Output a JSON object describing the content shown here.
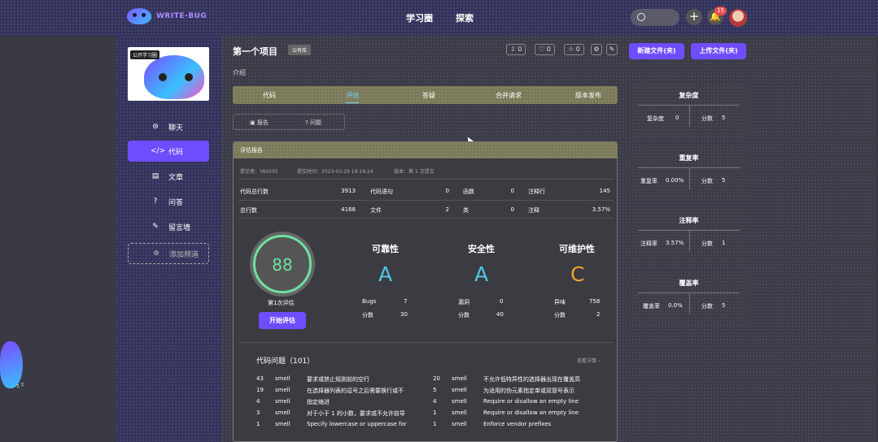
{
  "header": {
    "logo_text": "WRITE-BUG",
    "nav": [
      "学习圈",
      "探索"
    ],
    "notification_count": "15"
  },
  "sidebar": {
    "project_tag": "公开学习圈",
    "items": [
      {
        "label": "聊天",
        "icon": "chat-icon"
      },
      {
        "label": "代码",
        "icon": "code-icon"
      },
      {
        "label": "文章",
        "icon": "article-icon"
      },
      {
        "label": "问答",
        "icon": "question-icon"
      },
      {
        "label": "留言墙",
        "icon": "edit-icon"
      },
      {
        "label": "添加频道",
        "icon": "add-circle-icon"
      }
    ]
  },
  "project": {
    "title": "第一个项目",
    "visibility": "公有库",
    "intro": "介绍",
    "downloads": "0",
    "likes": "0",
    "stars": "0",
    "new_file": "新建文件(夹)",
    "upload_file": "上传文件(夹)"
  },
  "tabs": [
    "代码",
    "评估",
    "答疑",
    "合并请求",
    "版本发布"
  ],
  "subtabs": [
    "报告",
    "问题"
  ],
  "report": {
    "title": "评估报告",
    "submitter": "提交者：YA0555",
    "submit_time": "提交时间：2023-03-29 19:19:24",
    "version": "版本：第 1 次提交",
    "metrics": [
      {
        "label": "代码总行数",
        "value": "3913"
      },
      {
        "label": "代码语句",
        "value": "0"
      },
      {
        "label": "函数",
        "value": "0"
      },
      {
        "label": "注释行",
        "value": "145"
      },
      {
        "label": "总行数",
        "value": "4168"
      },
      {
        "label": "文件",
        "value": "2"
      },
      {
        "label": "类",
        "value": "0"
      },
      {
        "label": "注释",
        "value": "3.57%"
      }
    ],
    "score": "88",
    "eval_times": "第1次评估",
    "start_button": "开始评估",
    "categories": [
      {
        "title": "可靠性",
        "grade": "A",
        "color": "#4fc9e8",
        "k1": "Bugs",
        "v1": "7",
        "k2": "分数",
        "v2": "30"
      },
      {
        "title": "安全性",
        "grade": "A",
        "color": "#4fc9e8",
        "k1": "漏洞",
        "v1": "0",
        "k2": "分数",
        "v2": "40"
      },
      {
        "title": "可维护性",
        "grade": "C",
        "color": "#f0a030",
        "k1": "异味",
        "v1": "758",
        "k2": "分数",
        "v2": "2"
      }
    ],
    "issues_title": "代码问题（101）",
    "view_all": "查看详情 ›",
    "issues_left": [
      {
        "count": "43",
        "type": "smell",
        "desc": "要求或禁止规则前的空行"
      },
      {
        "count": "19",
        "type": "smell",
        "desc": "在选择器列表的逗号之后需要换行或不"
      },
      {
        "count": "4",
        "type": "smell",
        "desc": "指定缩进"
      },
      {
        "count": "3",
        "type": "smell",
        "desc": "对于小于 1 的小数，要求或不允许前导"
      },
      {
        "count": "1",
        "type": "smell",
        "desc": "Specify lowercase or uppercase for"
      }
    ],
    "issues_right": [
      {
        "count": "20",
        "type": "smell",
        "desc": "不允许低特异性的选择器出现在覆盖高"
      },
      {
        "count": "5",
        "type": "smell",
        "desc": "为适用的伪元素指定单或双冒号表示"
      },
      {
        "count": "4",
        "type": "smell",
        "desc": "Require or disallow an empty line"
      },
      {
        "count": "1",
        "type": "smell",
        "desc": "Require or disallow an empty line"
      },
      {
        "count": "1",
        "type": "smell",
        "desc": "Enforce vendor prefixes"
      }
    ]
  },
  "side_cards": [
    {
      "title": "复杂度",
      "k1": "复杂度",
      "v1": "0",
      "k2": "分数",
      "v2": "5"
    },
    {
      "title": "重复率",
      "k1": "重复率",
      "v1": "0.00%",
      "k2": "分数",
      "v2": "5"
    },
    {
      "title": "注释率",
      "k1": "注释率",
      "v1": "3.57%",
      "k2": "分数",
      "v2": "1"
    },
    {
      "title": "覆盖率",
      "k1": "覆盖率",
      "v1": "0.0%",
      "k2": "分数",
      "v2": "5"
    }
  ]
}
